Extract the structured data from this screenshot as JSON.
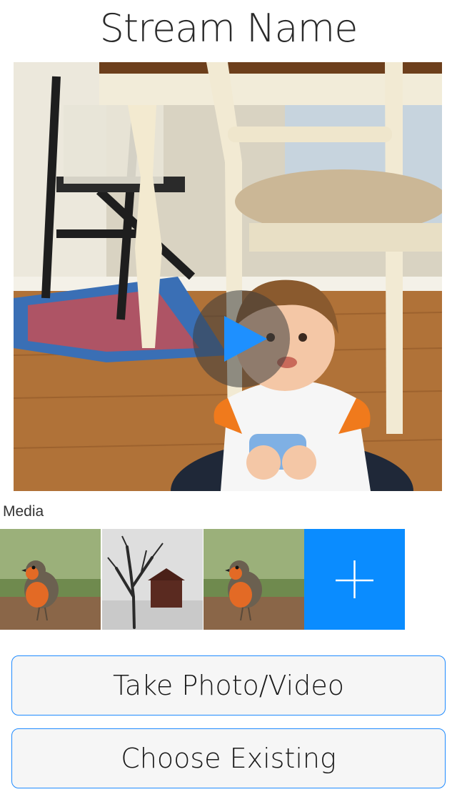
{
  "header": {
    "title": "Stream Name"
  },
  "preview": {
    "type": "video",
    "play_icon": "play-icon"
  },
  "media": {
    "label": "Media",
    "items": [
      {
        "kind": "photo",
        "subject": "robin"
      },
      {
        "kind": "photo",
        "subject": "tree-and-house"
      },
      {
        "kind": "photo",
        "subject": "robin"
      }
    ],
    "add_icon": "plus-icon"
  },
  "actions": {
    "take_label": "Take Photo/Video",
    "choose_label": "Choose Existing"
  },
  "colors": {
    "accent": "#0a8cff",
    "button_border": "#1f8bff",
    "button_bg": "#f6f6f6"
  }
}
